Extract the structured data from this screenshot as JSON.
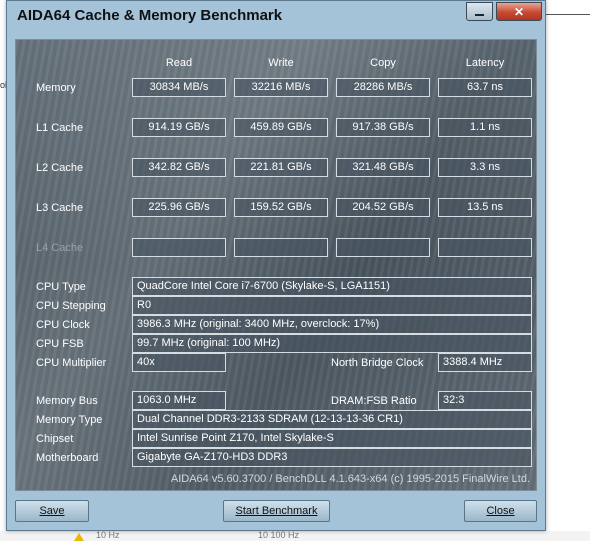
{
  "window": {
    "title": "AIDA64 Cache & Memory Benchmark",
    "minimize_glyph": "_",
    "maximize_glyph": "□",
    "close_glyph": "✕"
  },
  "columns": {
    "read": "Read",
    "write": "Write",
    "copy": "Copy",
    "latency": "Latency"
  },
  "rows": [
    {
      "label": "Memory",
      "read": "30834 MB/s",
      "write": "32216 MB/s",
      "copy": "28286 MB/s",
      "latency": "63.7 ns"
    },
    {
      "label": "L1 Cache",
      "read": "914.19 GB/s",
      "write": "459.89 GB/s",
      "copy": "917.38 GB/s",
      "latency": "1.1 ns"
    },
    {
      "label": "L2 Cache",
      "read": "342.82 GB/s",
      "write": "221.81 GB/s",
      "copy": "321.48 GB/s",
      "latency": "3.3 ns"
    },
    {
      "label": "L3 Cache",
      "read": "225.96 GB/s",
      "write": "159.52 GB/s",
      "copy": "204.52 GB/s",
      "latency": "13.5 ns"
    },
    {
      "label": "L4 Cache",
      "read": "",
      "write": "",
      "copy": "",
      "latency": ""
    }
  ],
  "cpu": {
    "type_label": "CPU Type",
    "type": "QuadCore Intel Core i7-6700  (Skylake-S, LGA1151)",
    "stepping_label": "CPU Stepping",
    "stepping": "R0",
    "clock_label": "CPU Clock",
    "clock": "3986.3 MHz  (original: 3400 MHz, overclock: 17%)",
    "fsb_label": "CPU FSB",
    "fsb": "99.7 MHz  (original: 100 MHz)",
    "multiplier_label": "CPU Multiplier",
    "multiplier": "40x",
    "nb_clock_label": "North Bridge Clock",
    "nb_clock": "3388.4 MHz"
  },
  "memory": {
    "bus_label": "Memory Bus",
    "bus": "1063.0 MHz",
    "ratio_label": "DRAM:FSB Ratio",
    "ratio": "32:3",
    "type_label": "Memory Type",
    "type": "Dual Channel DDR3-2133 SDRAM  (12-13-13-36 CR1)",
    "chipset_label": "Chipset",
    "chipset": "Intel Sunrise Point Z170, Intel Skylake-S",
    "motherboard_label": "Motherboard",
    "motherboard": "Gigabyte GA-Z170-HD3 DDR3"
  },
  "footer": {
    "version": "AIDA64 v5.60.3700 / BenchDLL 4.1.643-x64  (c) 1995-2015 FinalWire Ltd."
  },
  "buttons": {
    "save": "Save",
    "start": "Start Benchmark",
    "close": "Close"
  },
  "background": {
    "stub": "ol",
    "bottom_left": "10 Hz",
    "bottom_right": "10 100 Hz"
  }
}
